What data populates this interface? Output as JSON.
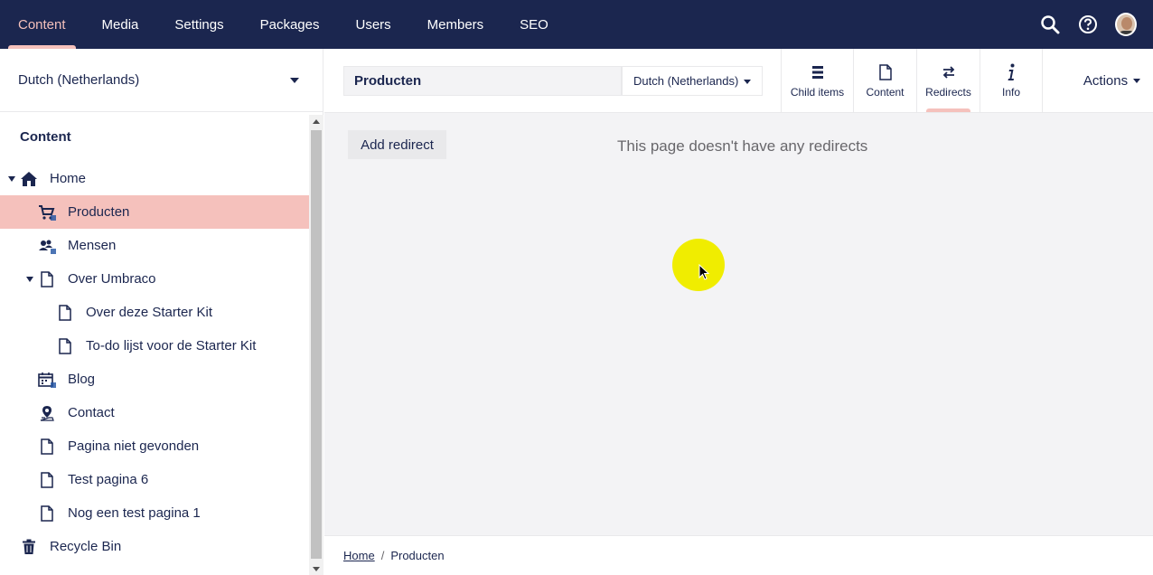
{
  "topnav": {
    "sections": [
      {
        "label": "Content",
        "active": true
      },
      {
        "label": "Media",
        "active": false
      },
      {
        "label": "Settings",
        "active": false
      },
      {
        "label": "Packages",
        "active": false
      },
      {
        "label": "Users",
        "active": false
      },
      {
        "label": "Members",
        "active": false
      },
      {
        "label": "SEO",
        "active": false
      }
    ],
    "tools": [
      "search-icon",
      "help-icon",
      "user-avatar"
    ]
  },
  "sidebar": {
    "language": "Dutch (Netherlands)",
    "tree_header": "Content",
    "tree": [
      {
        "label": "Home",
        "icon": "home-icon",
        "level": 0,
        "expanded": true
      },
      {
        "label": "Producten",
        "icon": "cart-icon",
        "level": 1,
        "selected": true
      },
      {
        "label": "Mensen",
        "icon": "people-icon",
        "level": 1
      },
      {
        "label": "Over Umbraco",
        "icon": "document-icon",
        "level": 1,
        "expanded": true
      },
      {
        "label": "Over deze Starter Kit",
        "icon": "document-icon",
        "level": 2
      },
      {
        "label": "To-do lijst voor de Starter Kit",
        "icon": "document-icon",
        "level": 2
      },
      {
        "label": "Blog",
        "icon": "calendar-icon",
        "level": 1
      },
      {
        "label": "Contact",
        "icon": "map-pin-icon",
        "level": 1
      },
      {
        "label": "Pagina niet gevonden",
        "icon": "document-icon",
        "level": 1
      },
      {
        "label": "Test pagina 6",
        "icon": "document-icon",
        "level": 1
      },
      {
        "label": "Nog een test pagina 1",
        "icon": "document-icon",
        "level": 1
      },
      {
        "label": "Recycle Bin",
        "icon": "trash-icon",
        "level": 0
      }
    ]
  },
  "editor": {
    "name": "Producten",
    "variant": "Dutch (Netherlands)",
    "apps": [
      {
        "label": "Child items",
        "icon": "list-icon",
        "active": false
      },
      {
        "label": "Content",
        "icon": "document-icon",
        "active": false
      },
      {
        "label": "Redirects",
        "icon": "arrows-swap-icon",
        "active": true
      },
      {
        "label": "Info",
        "icon": "info-icon",
        "active": false
      }
    ],
    "actions_label": "Actions"
  },
  "main": {
    "add_redirect_label": "Add redirect",
    "empty_message": "This page doesn't have any redirects"
  },
  "breadcrumb": {
    "items": [
      "Home",
      "Producten"
    ]
  },
  "colors": {
    "nav_bg": "#1b264f",
    "accent": "#f5c1bc",
    "cursor_highlight": "#f0ed00"
  }
}
